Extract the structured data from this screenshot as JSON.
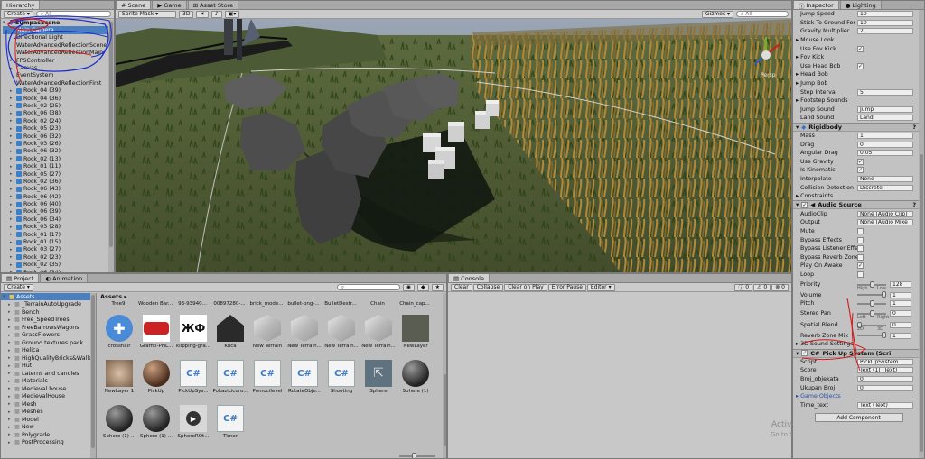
{
  "hierarchy": {
    "tab": "Hierarchy",
    "create": "Create",
    "search": "All",
    "scene": "SumpasScene",
    "items": [
      "Main Camera",
      "Directional Light",
      "WaterAdvancedReflectionScene",
      "WaterAdvancedReflectionMain",
      "FPSController",
      "Canvas",
      "EventSystem",
      "WaterAdvancedReflectionFirst",
      "Rock_04 (39)",
      "Rock_04 (36)",
      "Rock_02 (25)",
      "Rock_06 (38)",
      "Rock_02 (24)",
      "Rock_05 (23)",
      "Rock_06 (32)",
      "Rock_03 (26)",
      "Rock_06 (32)",
      "Rock_02 (13)",
      "Rock_01 (11)",
      "Rock_05 (27)",
      "Rock_02 (36)",
      "Rock_06 (43)",
      "Rock_06 (42)",
      "Rock_06 (40)",
      "Rock_06 (39)",
      "Rock_06 (34)",
      "Rock_03 (28)",
      "Rock_01 (17)",
      "Rock_01 (15)",
      "Rock_03 (27)",
      "Rock_02 (23)",
      "Rock_02 (35)",
      "Rock_06 (34)"
    ]
  },
  "scene": {
    "tabs": [
      "Scene",
      "Game",
      "Asset Store"
    ],
    "shading": "Sprite Mask",
    "mode": "3D",
    "gizmos": "Gizmos",
    "search": "All",
    "persp": "Persp"
  },
  "inspector": {
    "tabs": [
      "Inspector",
      "Lighting"
    ],
    "top_rows": [
      {
        "label": "Jump Speed",
        "value": "10"
      },
      {
        "label": "Stick To Ground For",
        "value": "10"
      },
      {
        "label": "Gravity Multiplier",
        "value": "2"
      },
      {
        "label": "Mouse Look",
        "value": ""
      },
      {
        "label": "Use Fov Kick",
        "value": "check"
      },
      {
        "label": "Fov Kick",
        "value": ""
      },
      {
        "label": "Use Head Bob",
        "value": "check"
      },
      {
        "label": "Head Bob",
        "value": ""
      },
      {
        "label": "Jump Bob",
        "value": ""
      },
      {
        "label": "Step Interval",
        "value": "5"
      },
      {
        "label": "Footstep Sounds",
        "value": ""
      },
      {
        "label": "Jump Sound",
        "value": "Jump"
      },
      {
        "label": "Land Sound",
        "value": "Land"
      }
    ],
    "rigidbody": {
      "title": "Rigidbody",
      "rows": [
        {
          "label": "Mass",
          "value": "1"
        },
        {
          "label": "Drag",
          "value": "0"
        },
        {
          "label": "Angular Drag",
          "value": "0.05"
        },
        {
          "label": "Use Gravity",
          "value": "check"
        },
        {
          "label": "Is Kinematic",
          "value": "check"
        },
        {
          "label": "Interpolate",
          "value": "None"
        },
        {
          "label": "Collision Detection",
          "value": "Discrete"
        },
        {
          "label": "Constraints",
          "value": ""
        }
      ]
    },
    "audio": {
      "title": "Audio Source",
      "rows": [
        {
          "label": "AudioClip",
          "value": "None (Audio Clip)"
        },
        {
          "label": "Output",
          "value": "None (Audio Mixe"
        },
        {
          "label": "Mute",
          "value": "empty"
        },
        {
          "label": "Bypass Effects",
          "value": "empty"
        },
        {
          "label": "Bypass Listener Effe",
          "value": "empty"
        },
        {
          "label": "Bypass Reverb Zone",
          "value": "empty"
        },
        {
          "label": "Play On Awake",
          "value": "check"
        },
        {
          "label": "Loop",
          "value": "empty"
        }
      ],
      "priority": {
        "label": "Priority",
        "value": "128",
        "hint_l": "High",
        "hint_r": "Low",
        "level": 0.5
      },
      "volume": {
        "label": "Volume",
        "value": "1",
        "level": 1
      },
      "pitch": {
        "label": "Pitch",
        "value": "1",
        "level": 0.5
      },
      "stereo": {
        "label": "Stereo Pan",
        "value": "0",
        "hint_l": "Left",
        "hint_r": "Right",
        "level": 0.5
      },
      "spatial": {
        "label": "Spatial Blend",
        "value": "0",
        "hint_l": "2D",
        "hint_r": "3D",
        "level": 0
      },
      "reverb": {
        "label": "Reverb Zone Mix",
        "value": "1",
        "level": 1
      },
      "settings": "3D Sound Settings"
    },
    "pickup": {
      "title": "Pick Up System (Scri",
      "rows": [
        {
          "label": "Script",
          "value": "PickUpSystem"
        },
        {
          "label": "Score",
          "value": "Text (1) (Text)"
        },
        {
          "label": "Broj_objekata",
          "value": "0"
        },
        {
          "label": "Ukupan Broj",
          "value": "0"
        },
        {
          "label": "Game Objects",
          "value": ""
        },
        {
          "label": "Time_text",
          "value": "Text (Text)"
        }
      ]
    },
    "add_component": "Add Component"
  },
  "project": {
    "tabs": [
      "Project",
      "Animation"
    ],
    "create": "Create",
    "tree_root": "Assets",
    "folders": [
      "_TerrainAutoUpgrade",
      "Bench",
      "Free_SpeedTrees",
      "FreeBarrowsWagons",
      "GrassFlowers",
      "Ground textures pack",
      "Helica",
      "HighQualityBricks&Walls",
      "Hut",
      "Laterns and candles",
      "Materials",
      "Medieval house",
      "MedievalHouse",
      "Mesh",
      "Meshes",
      "Model",
      "New",
      "Polygrade",
      "PostProcessing"
    ],
    "breadcrumb": "Assets",
    "top_labels": [
      "Tree9",
      "Wooden Bar...",
      "93-93940...",
      "00897280-...",
      "brick_mode...",
      "bullet-png-...",
      "BulletDestr...",
      "Chain",
      "Chain_cap..."
    ],
    "assets_row1": [
      "crosshair",
      "Graffiti-PNL...",
      "klipping-gra...",
      "Kuca",
      "New Terrain",
      "New Terrain...",
      "New Terrain...",
      "New Terrain...",
      "NewLayer"
    ],
    "assets_row2": [
      "NewLayer 1",
      "PickUp",
      "PickUpSys...",
      "PokaziLicuro...",
      "Pomocilevel",
      "RotateObje...",
      "Shooting",
      "Sphere",
      "Sphere (1)"
    ],
    "assets_row3": [
      "Sphere (1) ...",
      "Sphere (1) ...",
      "SphereROt...",
      "Timer"
    ]
  },
  "console": {
    "tab": "Console",
    "buttons": [
      "Clear",
      "Collapse",
      "Clear on Play",
      "Error Pause",
      "Editor"
    ],
    "counts": [
      "0",
      "0",
      "0"
    ]
  },
  "watermark": {
    "line1": "Activate Windows",
    "line2": "Go to Settings to activate Windows."
  }
}
